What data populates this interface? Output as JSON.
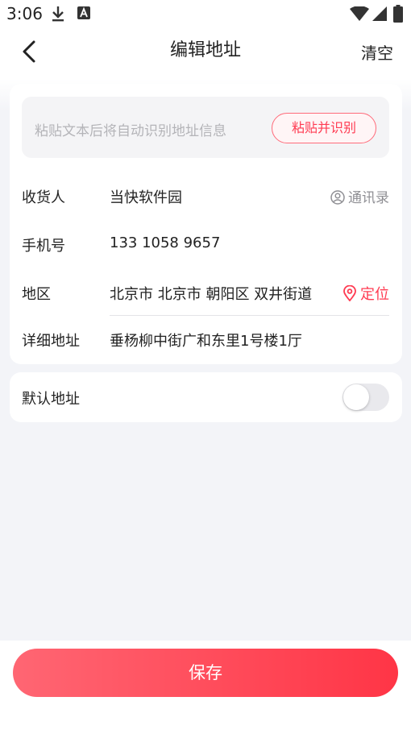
{
  "status_bar": {
    "time": "3:06"
  },
  "header": {
    "title": "编辑地址",
    "clear_label": "清空"
  },
  "paste": {
    "placeholder": "粘贴文本后将自动识别地址信息",
    "button_label": "粘贴并识别"
  },
  "form": {
    "recipient": {
      "label": "收货人",
      "value": "当快软件园",
      "contacts_label": "通讯录"
    },
    "phone": {
      "label": "手机号",
      "value": "133 1058 9657"
    },
    "region": {
      "label": "地区",
      "value": "北京市 北京市 朝阳区 双井街道",
      "locate_label": "定位"
    },
    "detail": {
      "label": "详细地址",
      "value": "垂杨柳中街广和东里1号楼1厅"
    }
  },
  "default_address": {
    "label": "默认地址",
    "enabled": false
  },
  "save_label": "保存",
  "colors": {
    "accent": "#ff3b52",
    "save_start": "#ff6673",
    "save_end": "#ff3546"
  }
}
